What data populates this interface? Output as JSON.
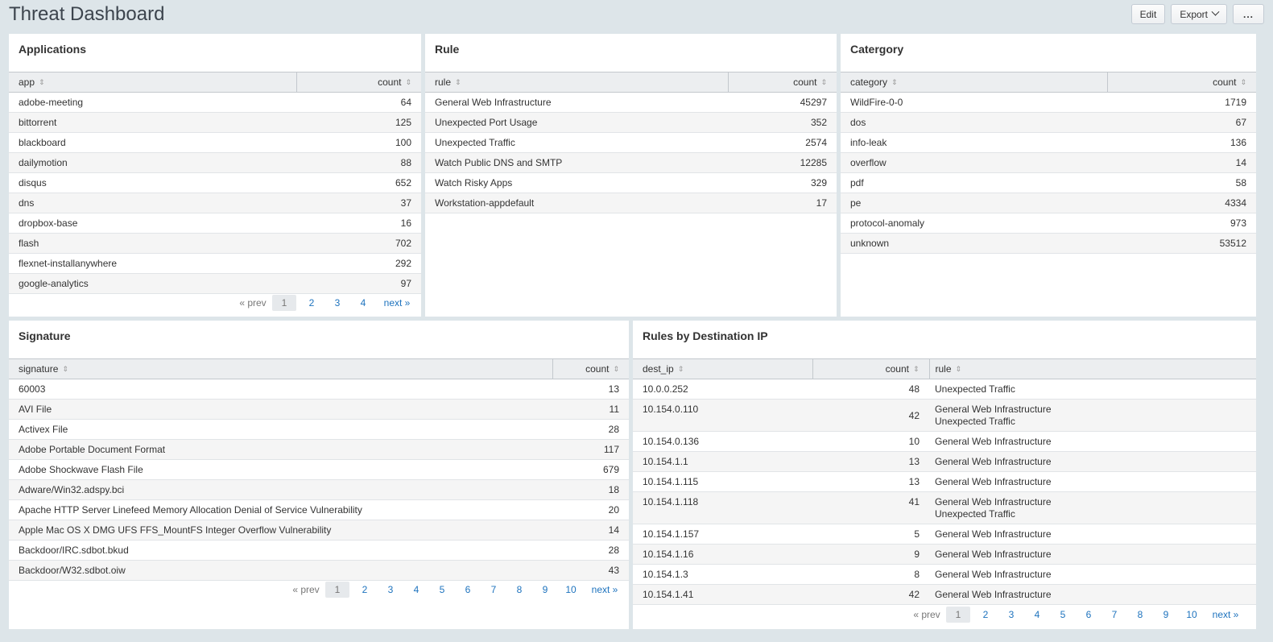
{
  "header": {
    "title": "Threat Dashboard",
    "edit_label": "Edit",
    "export_label": "Export",
    "more_label": "..."
  },
  "applications": {
    "title": "Applications",
    "col1": "app",
    "col2": "count",
    "rows": [
      {
        "name": "adobe-meeting",
        "count": "64"
      },
      {
        "name": "bittorrent",
        "count": "125"
      },
      {
        "name": "blackboard",
        "count": "100"
      },
      {
        "name": "dailymotion",
        "count": "88"
      },
      {
        "name": "disqus",
        "count": "652"
      },
      {
        "name": "dns",
        "count": "37"
      },
      {
        "name": "dropbox-base",
        "count": "16"
      },
      {
        "name": "flash",
        "count": "702"
      },
      {
        "name": "flexnet-installanywhere",
        "count": "292"
      },
      {
        "name": "google-analytics",
        "count": "97"
      }
    ],
    "pager": {
      "prev": "« prev",
      "current": "1",
      "pages": [
        "2",
        "3",
        "4"
      ],
      "next": "next »"
    }
  },
  "rule": {
    "title": "Rule",
    "col1": "rule",
    "col2": "count",
    "rows": [
      {
        "name": "General Web Infrastructure",
        "count": "45297"
      },
      {
        "name": "Unexpected Port Usage",
        "count": "352"
      },
      {
        "name": "Unexpected Traffic",
        "count": "2574"
      },
      {
        "name": "Watch Public DNS and SMTP",
        "count": "12285"
      },
      {
        "name": "Watch Risky Apps",
        "count": "329"
      },
      {
        "name": "Workstation-appdefault",
        "count": "17"
      }
    ]
  },
  "category": {
    "title": "Catergory",
    "col1": "category",
    "col2": "count",
    "rows": [
      {
        "name": "WildFire-0-0",
        "count": "1719"
      },
      {
        "name": "dos",
        "count": "67"
      },
      {
        "name": "info-leak",
        "count": "136"
      },
      {
        "name": "overflow",
        "count": "14"
      },
      {
        "name": "pdf",
        "count": "58"
      },
      {
        "name": "pe",
        "count": "4334"
      },
      {
        "name": "protocol-anomaly",
        "count": "973"
      },
      {
        "name": "unknown",
        "count": "53512"
      }
    ]
  },
  "signature": {
    "title": "Signature",
    "col1": "signature",
    "col2": "count",
    "rows": [
      {
        "name": "60003",
        "count": "13"
      },
      {
        "name": "AVI File",
        "count": "11"
      },
      {
        "name": "Activex File",
        "count": "28"
      },
      {
        "name": "Adobe Portable Document Format",
        "count": "117"
      },
      {
        "name": "Adobe Shockwave Flash File",
        "count": "679"
      },
      {
        "name": "Adware/Win32.adspy.bci",
        "count": "18"
      },
      {
        "name": "Apache HTTP Server Linefeed Memory Allocation Denial of Service Vulnerability",
        "count": "20"
      },
      {
        "name": "Apple Mac OS X DMG UFS FFS_MountFS Integer Overflow Vulnerability",
        "count": "14"
      },
      {
        "name": "Backdoor/IRC.sdbot.bkud",
        "count": "28"
      },
      {
        "name": "Backdoor/W32.sdbot.oiw",
        "count": "43"
      }
    ],
    "pager": {
      "prev": "« prev",
      "current": "1",
      "pages": [
        "2",
        "3",
        "4",
        "5",
        "6",
        "7",
        "8",
        "9",
        "10"
      ],
      "next": "next »"
    }
  },
  "dest_ip": {
    "title": "Rules by Destination IP",
    "col1": "dest_ip",
    "col2": "count",
    "col3": "rule",
    "rows": [
      {
        "ip": "10.0.0.252",
        "count": "48",
        "rules": [
          "Unexpected Traffic"
        ]
      },
      {
        "ip": "10.154.0.110",
        "count": "42",
        "rules": [
          "General Web Infrastructure",
          "Unexpected Traffic"
        ]
      },
      {
        "ip": "10.154.0.136",
        "count": "10",
        "rules": [
          "General Web Infrastructure"
        ]
      },
      {
        "ip": "10.154.1.1",
        "count": "13",
        "rules": [
          "General Web Infrastructure"
        ]
      },
      {
        "ip": "10.154.1.115",
        "count": "13",
        "rules": [
          "General Web Infrastructure"
        ]
      },
      {
        "ip": "10.154.1.118",
        "count": "41",
        "rules": [
          "General Web Infrastructure",
          "Unexpected Traffic"
        ]
      },
      {
        "ip": "10.154.1.157",
        "count": "5",
        "rules": [
          "General Web Infrastructure"
        ]
      },
      {
        "ip": "10.154.1.16",
        "count": "9",
        "rules": [
          "General Web Infrastructure"
        ]
      },
      {
        "ip": "10.154.1.3",
        "count": "8",
        "rules": [
          "General Web Infrastructure"
        ]
      },
      {
        "ip": "10.154.1.41",
        "count": "42",
        "rules": [
          "General Web Infrastructure"
        ]
      }
    ],
    "pager": {
      "prev": "« prev",
      "current": "1",
      "pages": [
        "2",
        "3",
        "4",
        "5",
        "6",
        "7",
        "8",
        "9",
        "10"
      ],
      "next": "next »"
    }
  }
}
